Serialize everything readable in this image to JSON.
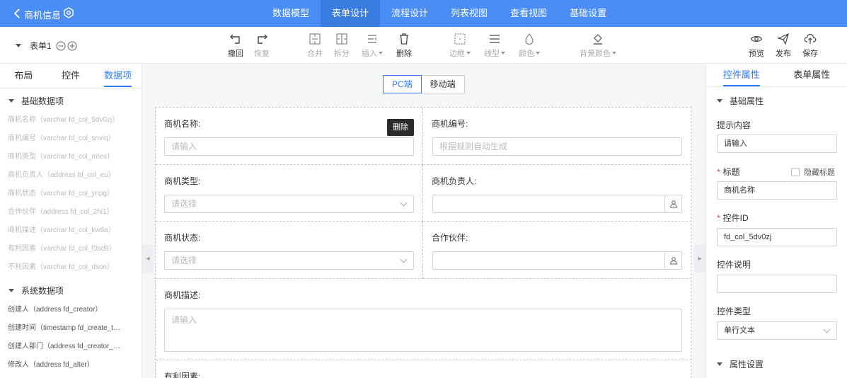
{
  "topbar": {
    "title": "商机信息",
    "tabs": [
      {
        "label": "数据模型"
      },
      {
        "label": "表单设计"
      },
      {
        "label": "流程设计"
      },
      {
        "label": "列表视图"
      },
      {
        "label": "查看视图"
      },
      {
        "label": "基础设置"
      }
    ],
    "active_tab": "表单设计"
  },
  "toolbar": {
    "form_name": "表单1",
    "undo": "撤回",
    "redo": "恢复",
    "merge": "合并",
    "split": "拆分",
    "insert": "插入",
    "delete": "删除",
    "border": "边框",
    "line_type": "线型",
    "color": "颜色",
    "bg_color": "背景颜色",
    "preview": "预览",
    "publish": "发布",
    "save": "保存"
  },
  "left": {
    "tabs": [
      "布局",
      "控件",
      "数据项"
    ],
    "active_tab": "数据项",
    "basic_group": "基础数据项",
    "basic_items": [
      "商机名称（varchar fd_col_5dv0zj）",
      "商机编号（varchar fd_col_snviq）",
      "商机类型（varchar fd_col_mtes）",
      "商机负责人（address fd_col_eu）",
      "商机状态（varchar fd_col_ynpg）",
      "合作伙伴（address fd_col_2hi1）",
      "商机描述（varchar fd_col_kw8a）",
      "有利因素（varchar fd_col_f3sd9）",
      "不利因素（varchar fd_col_dson）"
    ],
    "system_group": "系统数据项",
    "system_items": [
      "创建人（address fd_creator）",
      "创建时间（timestamp fd_create_time）",
      "创建人部门（address fd_creator_dept）",
      "修改人（address fd_alter）"
    ]
  },
  "canvas": {
    "pc_label": "PC端",
    "mobile_label": "移动端",
    "delete_tip": "删除",
    "fields": {
      "name_label": "商机名称:",
      "name_placeholder": "请输入",
      "code_label": "商机编号:",
      "code_placeholder": "根据规则自动生成",
      "type_label": "商机类型:",
      "type_placeholder": "请选择",
      "owner_label": "商机负责人:",
      "status_label": "商机状态:",
      "status_placeholder": "请选择",
      "partner_label": "合作伙伴:",
      "desc_label": "商机描述:",
      "desc_placeholder": "请输入",
      "favorable_label": "有利因素:"
    }
  },
  "right": {
    "tabs": [
      "控件属性",
      "表单属性"
    ],
    "active_tab": "控件属性",
    "basic_group": "基础属性",
    "hint_label": "提示内容",
    "hint_value": "请输入",
    "title_label": "标题",
    "hide_title": "隐藏标题",
    "title_value": "商机名称",
    "id_label": "控件ID",
    "id_value": "fd_col_5dv0zj",
    "desc_label": "控件说明",
    "desc_value": "",
    "type_label": "控件类型",
    "type_value": "单行文本",
    "attr_group": "属性设置"
  },
  "colors": {
    "primary": "#4a8ef5",
    "accent": "#2f7cf5",
    "required": "#e44"
  }
}
